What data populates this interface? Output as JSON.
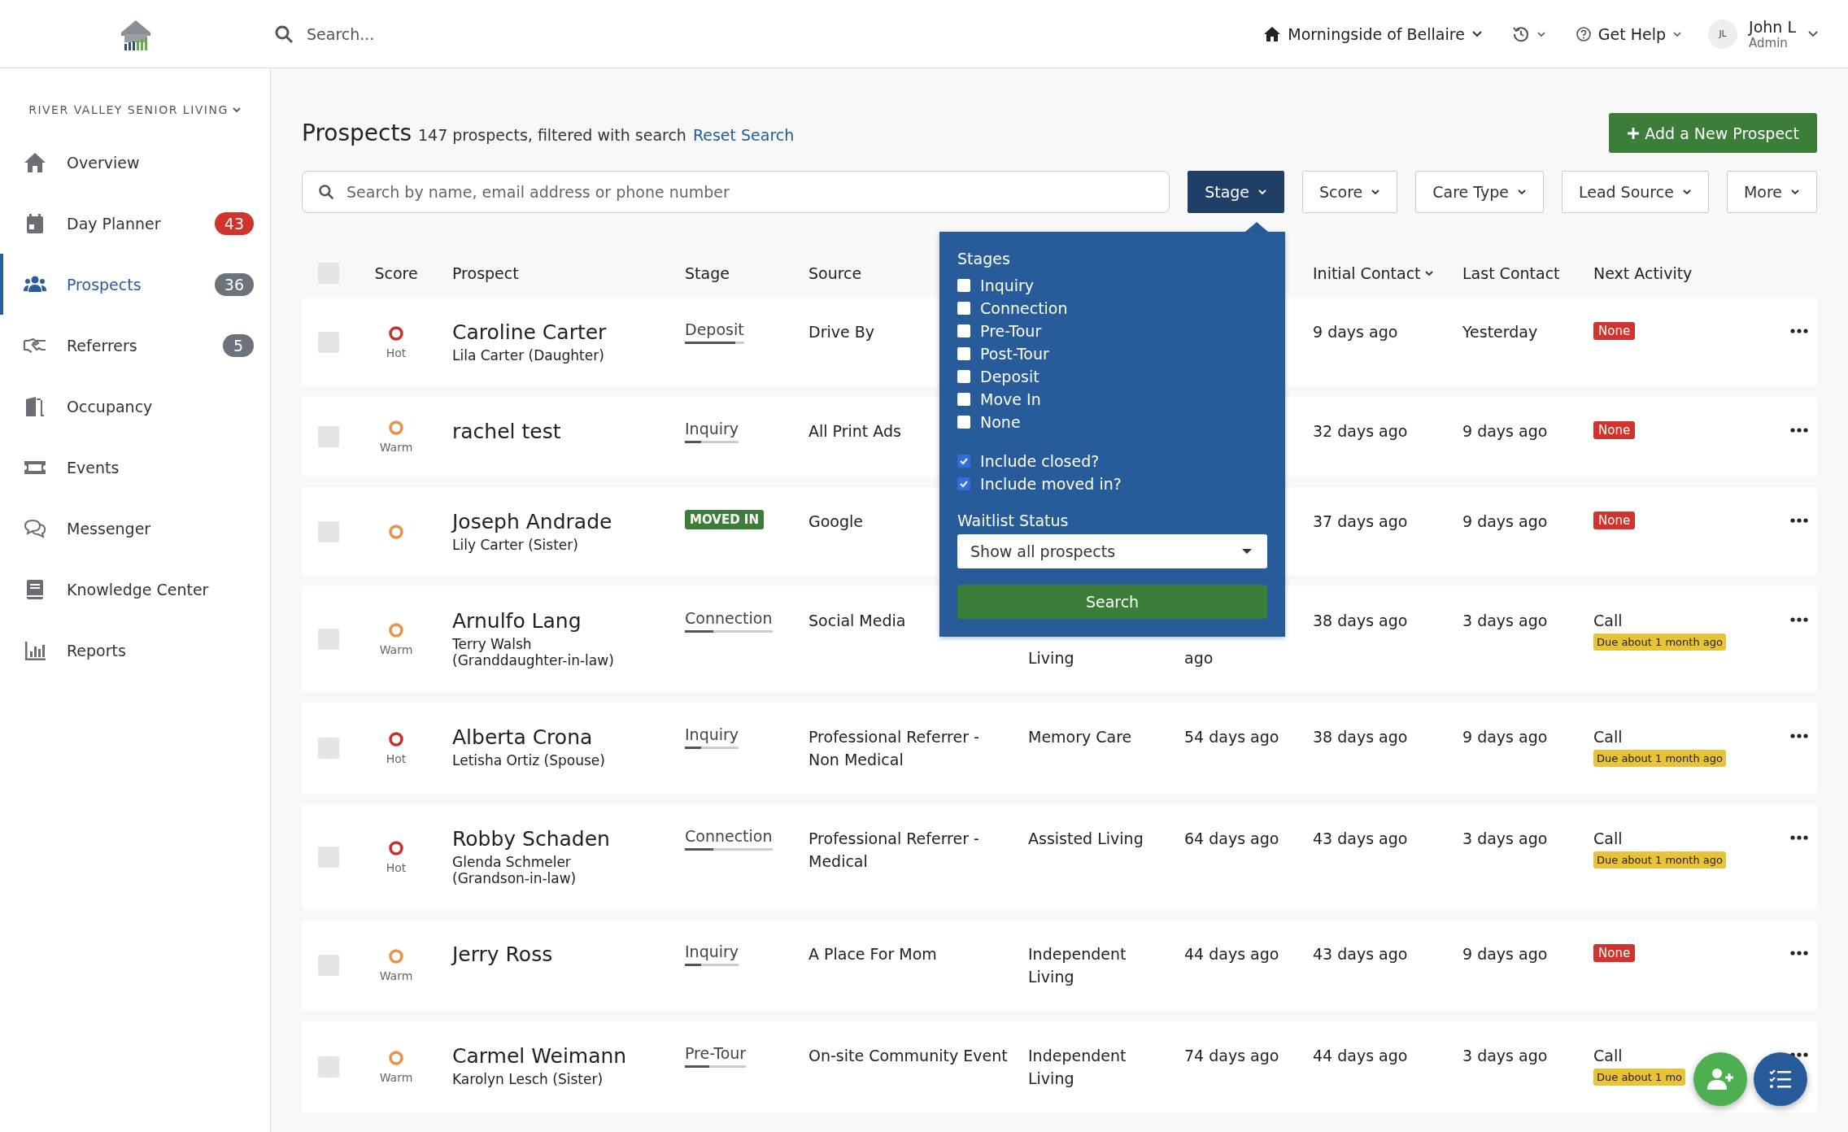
{
  "topbar": {
    "search": {
      "placeholder": "Search..."
    },
    "community": "Morningside of Bellaire",
    "help": "Get Help",
    "user": {
      "initials": "JL",
      "name": "John L",
      "role": "Admin"
    }
  },
  "sidebar": {
    "org": "RIVER VALLEY SENIOR LIVING",
    "items": [
      {
        "label": "Overview",
        "selected": false
      },
      {
        "label": "Day Planner",
        "selected": false,
        "badge": {
          "text": "43",
          "color": "#d0342c"
        }
      },
      {
        "label": "Prospects",
        "selected": true,
        "badge": {
          "text": "36",
          "color": "#6c737b"
        }
      },
      {
        "label": "Referrers",
        "selected": false,
        "badge": {
          "text": "5",
          "color": "#6c737b"
        }
      },
      {
        "label": "Occupancy",
        "selected": false
      },
      {
        "label": "Events",
        "selected": false
      },
      {
        "label": "Messenger",
        "selected": false
      },
      {
        "label": "Knowledge Center",
        "selected": false
      },
      {
        "label": "Reports",
        "selected": false
      }
    ]
  },
  "page": {
    "title": "Prospects",
    "summary": "147 prospects, filtered with search",
    "reset_link": "Reset Search",
    "add_button": "Add a New Prospect",
    "search": {
      "placeholder": "Search by name, email address or phone number"
    },
    "filters": [
      {
        "label": "Stage",
        "selected": true
      },
      {
        "label": "Score",
        "selected": false
      },
      {
        "label": "Care Type",
        "selected": false
      },
      {
        "label": "Lead Source",
        "selected": false
      },
      {
        "label": "More",
        "selected": false
      }
    ]
  },
  "stage_menu": {
    "heading": "Stages",
    "stages": [
      {
        "label": "Inquiry",
        "checked": false
      },
      {
        "label": "Connection",
        "checked": false
      },
      {
        "label": "Pre-Tour",
        "checked": false
      },
      {
        "label": "Post-Tour",
        "checked": false
      },
      {
        "label": "Deposit",
        "checked": false
      },
      {
        "label": "Move In",
        "checked": false
      },
      {
        "label": "None",
        "checked": false
      }
    ],
    "options": [
      {
        "label": "Include closed?",
        "checked": true
      },
      {
        "label": "Include moved in?",
        "checked": true
      }
    ],
    "waitlist_label": "Waitlist Status",
    "waitlist_value": "Show all prospects",
    "button": "Search"
  },
  "table": {
    "select_all": {
      "selected": false
    },
    "columns": {
      "score": "Score",
      "prospect": "Prospect",
      "stage": "Stage",
      "source": "Source",
      "initial_contact": "Initial Contact",
      "last_contact": "Last Contact",
      "next_activity": "Next Activity"
    },
    "rows": [
      {
        "selected": false,
        "score": {
          "kind": "hot",
          "label": "Hot"
        },
        "name": "Caroline Carter",
        "contact": "Lila Carter (Daughter)",
        "stage": {
          "kind": "progress",
          "label": "Deposit",
          "level": 0.85
        },
        "source": "Drive By",
        "initial_contact": "9 days ago",
        "last_contact": "Yesterday",
        "next": {
          "kind": "none",
          "label": "None"
        }
      },
      {
        "selected": false,
        "score": {
          "kind": "warm",
          "label": "Warm"
        },
        "name": "rachel test",
        "stage": {
          "kind": "progress",
          "label": "Inquiry",
          "level": 0.3
        },
        "source": "All Print Ads",
        "initial_contact": "32 days ago",
        "last_contact": "9 days ago",
        "next": {
          "kind": "none",
          "label": "None"
        }
      },
      {
        "selected": false,
        "score": {
          "kind": "warm"
        },
        "name": "Joseph Andrade",
        "contact": "Lily Carter (Sister)",
        "stage": {
          "kind": "badge",
          "label": "MOVED IN"
        },
        "source": "Google",
        "initial_contact": "37 days ago",
        "last_contact": "9 days ago",
        "next": {
          "kind": "none",
          "label": "None"
        }
      },
      {
        "selected": false,
        "score": {
          "kind": "warm",
          "label": "Warm"
        },
        "name": "Arnulfo Lang",
        "contact": "Terry Walsh (Granddaughter-in-law)",
        "stage": {
          "kind": "progress",
          "label": "Connection",
          "level": 0.33
        },
        "source": "Social Media",
        "column_5": "Living",
        "column_6": "ago",
        "partly_covered": true,
        "initial_contact": "38 days ago",
        "last_contact": "3 days ago",
        "next": {
          "kind": "call",
          "label": "Call",
          "due": "Due about 1 month ago"
        }
      },
      {
        "selected": false,
        "score": {
          "kind": "hot",
          "label": "Hot"
        },
        "name": "Alberta Crona",
        "contact": "Letisha Ortiz (Spouse)",
        "stage": {
          "kind": "progress",
          "label": "Inquiry",
          "level": 0.3
        },
        "source": "Professional Referrer - Non Medical",
        "column_5": "Memory Care",
        "column_6": "54 days ago",
        "initial_contact": "38 days ago",
        "last_contact": "9 days ago",
        "next": {
          "kind": "call",
          "label": "Call",
          "due": "Due about 1 month ago"
        }
      },
      {
        "selected": false,
        "score": {
          "kind": "hot",
          "label": "Hot"
        },
        "name": "Robby Schaden",
        "contact": "Glenda Schmeler (Grandson-in-law)",
        "stage": {
          "kind": "progress",
          "label": "Connection",
          "level": 0.33
        },
        "source": "Professional Referrer - Medical",
        "column_5": "Assisted Living",
        "column_6": "64 days ago",
        "initial_contact": "43 days ago",
        "last_contact": "3 days ago",
        "next": {
          "kind": "call",
          "label": "Call",
          "due": "Due about 1 month ago"
        }
      },
      {
        "selected": false,
        "score": {
          "kind": "warm",
          "label": "Warm"
        },
        "name": "Jerry Ross",
        "stage": {
          "kind": "progress",
          "label": "Inquiry",
          "level": 0.3
        },
        "source": "A Place For Mom",
        "column_5": "Independent Living",
        "column_6": "44 days ago",
        "initial_contact": "43 days ago",
        "last_contact": "9 days ago",
        "next": {
          "kind": "none",
          "label": "None"
        }
      },
      {
        "selected": false,
        "score": {
          "kind": "warm",
          "label": "Warm"
        },
        "name": "Carmel Weimann",
        "contact": "Karolyn Lesch (Sister)",
        "stage": {
          "kind": "progress",
          "label": "Pre-Tour",
          "level": 0.4
        },
        "source": "On-site Community Event",
        "column_5": "Independent Living",
        "column_6": "74 days ago",
        "initial_contact": "44 days ago",
        "last_contact": "3 days ago",
        "next": {
          "kind": "call",
          "label": "Call",
          "due": "Due about 1 mo"
        }
      }
    ]
  }
}
